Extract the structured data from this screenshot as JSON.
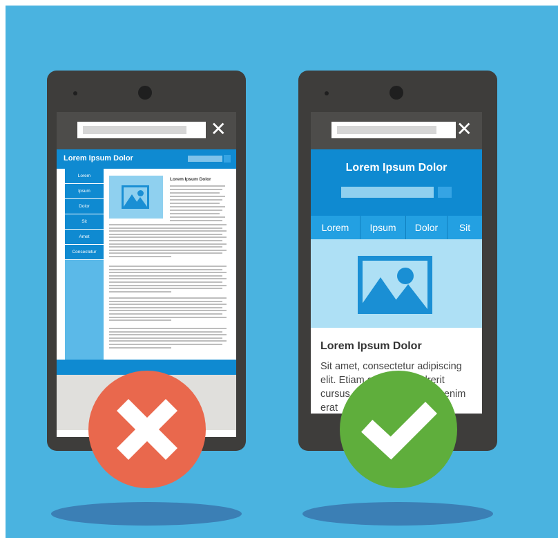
{
  "bad_phone": {
    "site_title": "Lorem Ipsum Dolor",
    "nav_items": [
      "Lorem",
      "Ipsum",
      "Dolor",
      "Sit",
      "Amet",
      "Consectetur"
    ],
    "article_heading": "Lorem Ipsum Dolor",
    "status_icon": "x-mark-icon"
  },
  "good_phone": {
    "site_title": "Lorem Ipsum Dolor",
    "nav_items": [
      "Lorem",
      "Ipsum",
      "Dolor",
      "Sit"
    ],
    "article_heading": "Lorem Ipsum Dolor",
    "article_body": "Sit amet, consectetur adipiscing elit. Etiam egestas hendrerit cursus. Phasellus lectus ac enim",
    "article_body_tail": "erat",
    "status_icon": "checkmark-icon"
  },
  "colors": {
    "background": "#4ab3e0",
    "phone_body": "#3e3d3b",
    "site_blue": "#0f8ad1",
    "bad_badge": "#e9684d",
    "good_badge": "#5fae3c"
  }
}
